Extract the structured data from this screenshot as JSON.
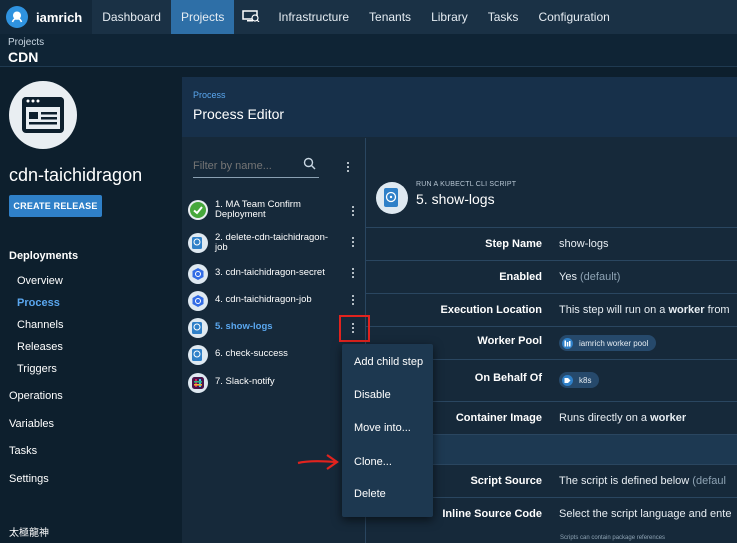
{
  "topnav": {
    "user": "iamrich",
    "items": [
      "Dashboard",
      "Projects",
      "",
      "Infrastructure",
      "Tenants",
      "Library",
      "Tasks",
      "Configuration"
    ],
    "active": "Projects",
    "icons": {
      "brand": "octopus-avatar-icon",
      "machines": "monitor-icon"
    }
  },
  "subheader": {
    "crumb": "Projects",
    "title": "CDN"
  },
  "sidebar": {
    "project_name": "cdn-taichidragon",
    "create_release": "CREATE RELEASE",
    "deployments": "Deployments",
    "deployment_links": [
      "Overview",
      "Process",
      "Channels",
      "Releases",
      "Triggers"
    ],
    "active_link": "Process",
    "other": [
      "Operations",
      "Variables",
      "Tasks",
      "Settings"
    ],
    "footer": "太極龍神"
  },
  "editor": {
    "crumb": "Process",
    "title": "Process Editor",
    "filter_placeholder": "Filter by name...",
    "steps": [
      {
        "label": "1. MA Team Confirm Deployment",
        "icon": "check-circle-icon"
      },
      {
        "label": "2. delete-cdn-taichidragon-job",
        "icon": "kubectl-script-icon"
      },
      {
        "label": "3. cdn-taichidragon-secret",
        "icon": "kubernetes-icon"
      },
      {
        "label": "4. cdn-taichidragon-job",
        "icon": "kubernetes-icon"
      },
      {
        "label": "5. show-logs",
        "icon": "kubectl-script-icon"
      },
      {
        "label": "6. check-success",
        "icon": "kubectl-script-icon"
      },
      {
        "label": "7. Slack-notify",
        "icon": "slack-icon"
      }
    ],
    "selected_step": "5. show-logs"
  },
  "detail": {
    "kind": "RUN A KUBECTL CLI SCRIPT",
    "name": "5. show-logs",
    "rows": {
      "step_name": {
        "label": "Step Name",
        "value": "show-logs"
      },
      "enabled": {
        "label": "Enabled",
        "value": "Yes",
        "muted": "(default)"
      },
      "execution_location": {
        "label": "Execution Location",
        "prefix": "This step will run on a",
        "bold": "worker",
        "suffix": "from"
      },
      "worker_pool": {
        "label": "Worker Pool",
        "chip": "iamrich worker pool"
      },
      "on_behalf_of": {
        "label": "On Behalf Of",
        "chip": "k8s"
      },
      "container_image": {
        "label": "Container Image",
        "prefix": "Runs directly on a",
        "bold": "worker"
      },
      "script_source": {
        "label": "Script Source",
        "value": "The script is defined below",
        "muted": "(defaul"
      },
      "inline_source": {
        "label": "Inline Source Code",
        "value": "Select the script language and ente"
      }
    },
    "note": "Scripts can contain package references"
  },
  "context_menu": {
    "items": [
      "Add child step",
      "Disable",
      "Move into...",
      "Clone...",
      "Delete"
    ]
  },
  "colors": {
    "accent": "#2f80c8",
    "active_link": "#5aa7ef",
    "annotation": "#e1231e"
  }
}
